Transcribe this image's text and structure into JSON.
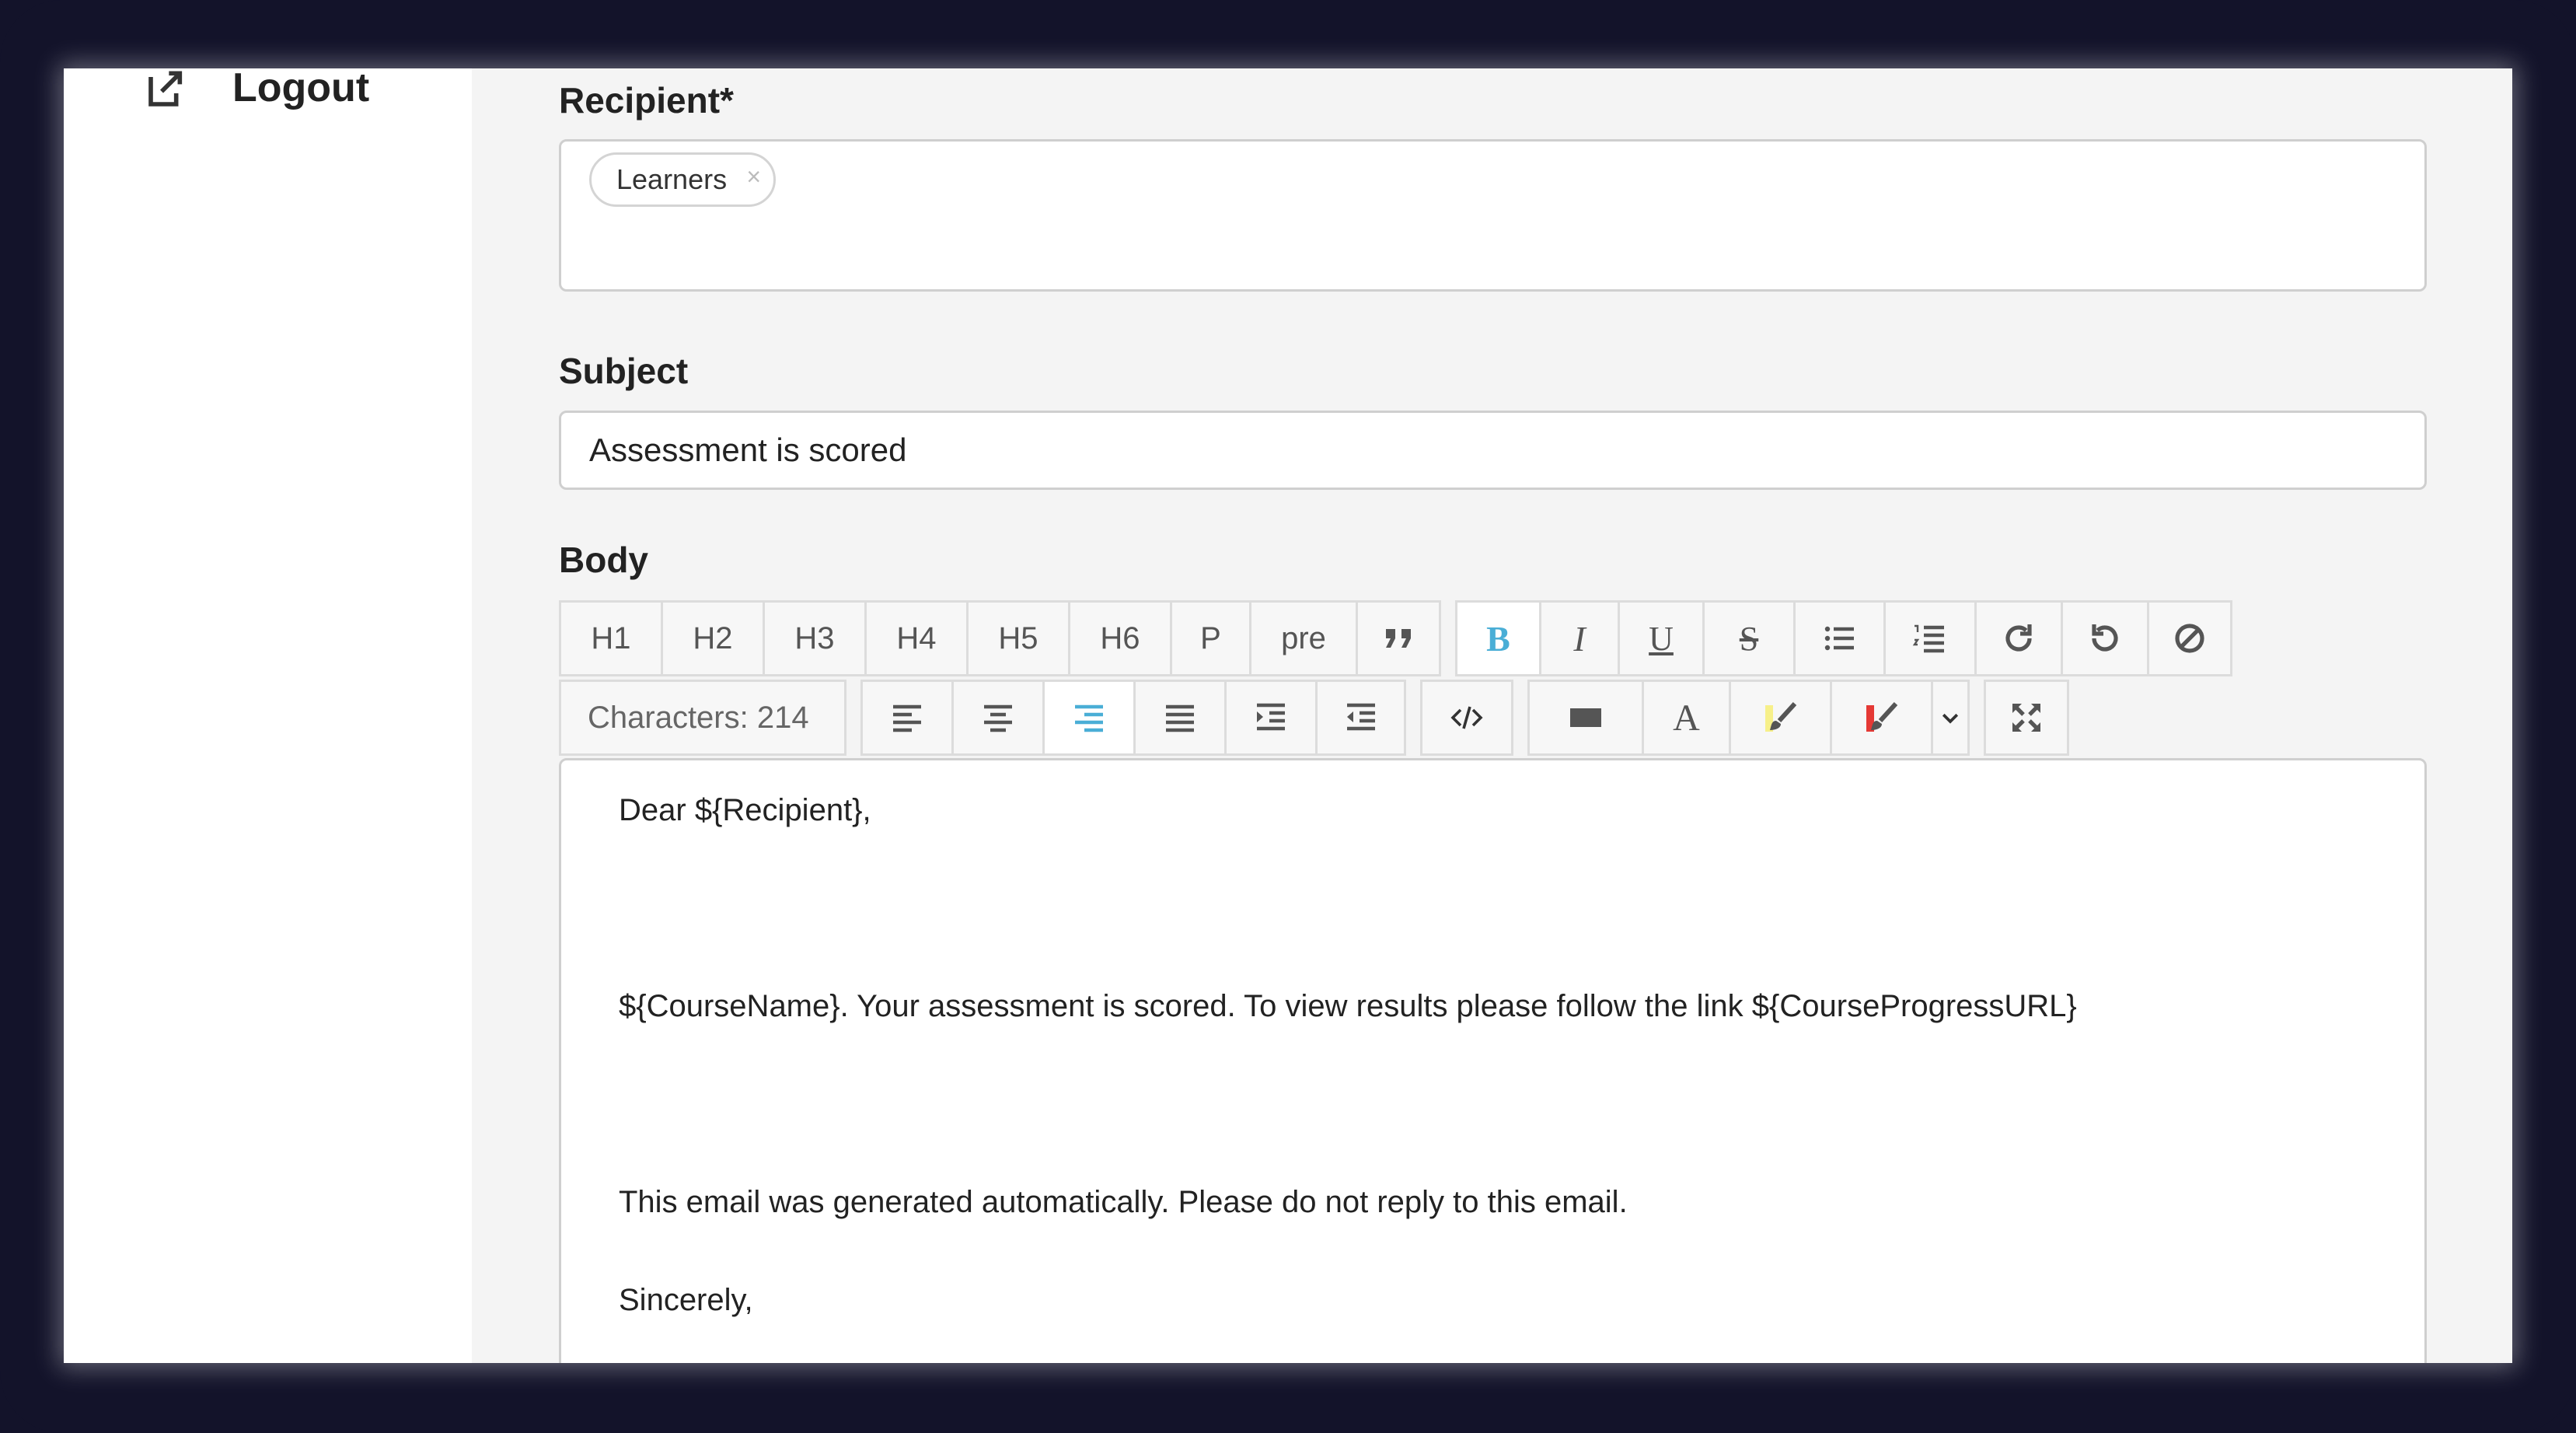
{
  "sidebar": {
    "logout_label": "Logout"
  },
  "recipient": {
    "label": "Recipient*",
    "chips": [
      "Learners"
    ],
    "chip_remove": "×"
  },
  "subject": {
    "label": "Subject",
    "value": "Assessment is scored"
  },
  "body": {
    "label": "Body",
    "headings": [
      "H1",
      "H2",
      "H3",
      "H4",
      "H5",
      "H6",
      "P",
      "pre"
    ],
    "characters": "Characters: 214",
    "text_color_icon": "A",
    "lines": [
      "Dear ${Recipient},",
      "${CourseName}. Your assessment is scored. To view results please follow the link ${CourseProgressURL}",
      "This email was generated automatically. Please do not reply to this email.",
      "Sincerely,"
    ]
  },
  "colors": {
    "accent": "#4aaed6",
    "highlight_yellow": "#f7f08a",
    "highlight_red": "#e53935"
  },
  "icons": [
    "logout-icon",
    "quote-icon",
    "bold-icon",
    "italic-icon",
    "underline-icon",
    "strikethrough-icon",
    "bulleted-list-icon",
    "numbered-list-icon",
    "redo-icon",
    "undo-icon",
    "clear-format-icon",
    "align-left-icon",
    "align-center-icon",
    "align-right-icon",
    "align-justify-icon",
    "indent-icon",
    "outdent-icon",
    "code-icon",
    "background-color-icon",
    "text-color-icon",
    "highlight-color-icon",
    "font-color-icon",
    "dropdown-icon",
    "fullscreen-icon"
  ]
}
